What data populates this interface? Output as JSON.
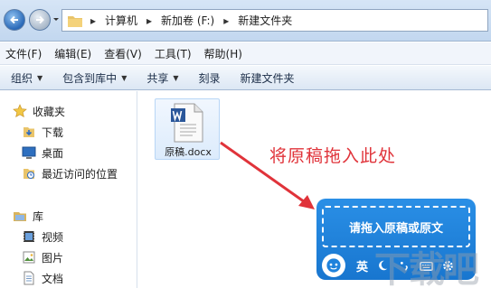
{
  "address_bar": {
    "crumbs": [
      "计算机",
      "新加卷 (F:)",
      "新建文件夹"
    ]
  },
  "menu": [
    "文件(F)",
    "编辑(E)",
    "查看(V)",
    "工具(T)",
    "帮助(H)"
  ],
  "toolbar": {
    "organize": "组织",
    "include_in_library": "包含到库中",
    "share": "共享",
    "burn": "刻录",
    "new_folder": "新建文件夹"
  },
  "nav_pane": {
    "favorites": "收藏夹",
    "downloads": "下载",
    "desktop": "桌面",
    "recent": "最近访问的位置",
    "libraries": "库",
    "videos": "视频",
    "pictures": "图片",
    "documents": "文档"
  },
  "content": {
    "file_name": "原稿.docx",
    "hint": "将原稿拖入此处"
  },
  "widget": {
    "prompt": "请拖入原稿或原文",
    "lang": "英"
  },
  "colors": {
    "hint": "#e0333a",
    "widget": "#1f82dc",
    "word_blue": "#2b579a"
  }
}
